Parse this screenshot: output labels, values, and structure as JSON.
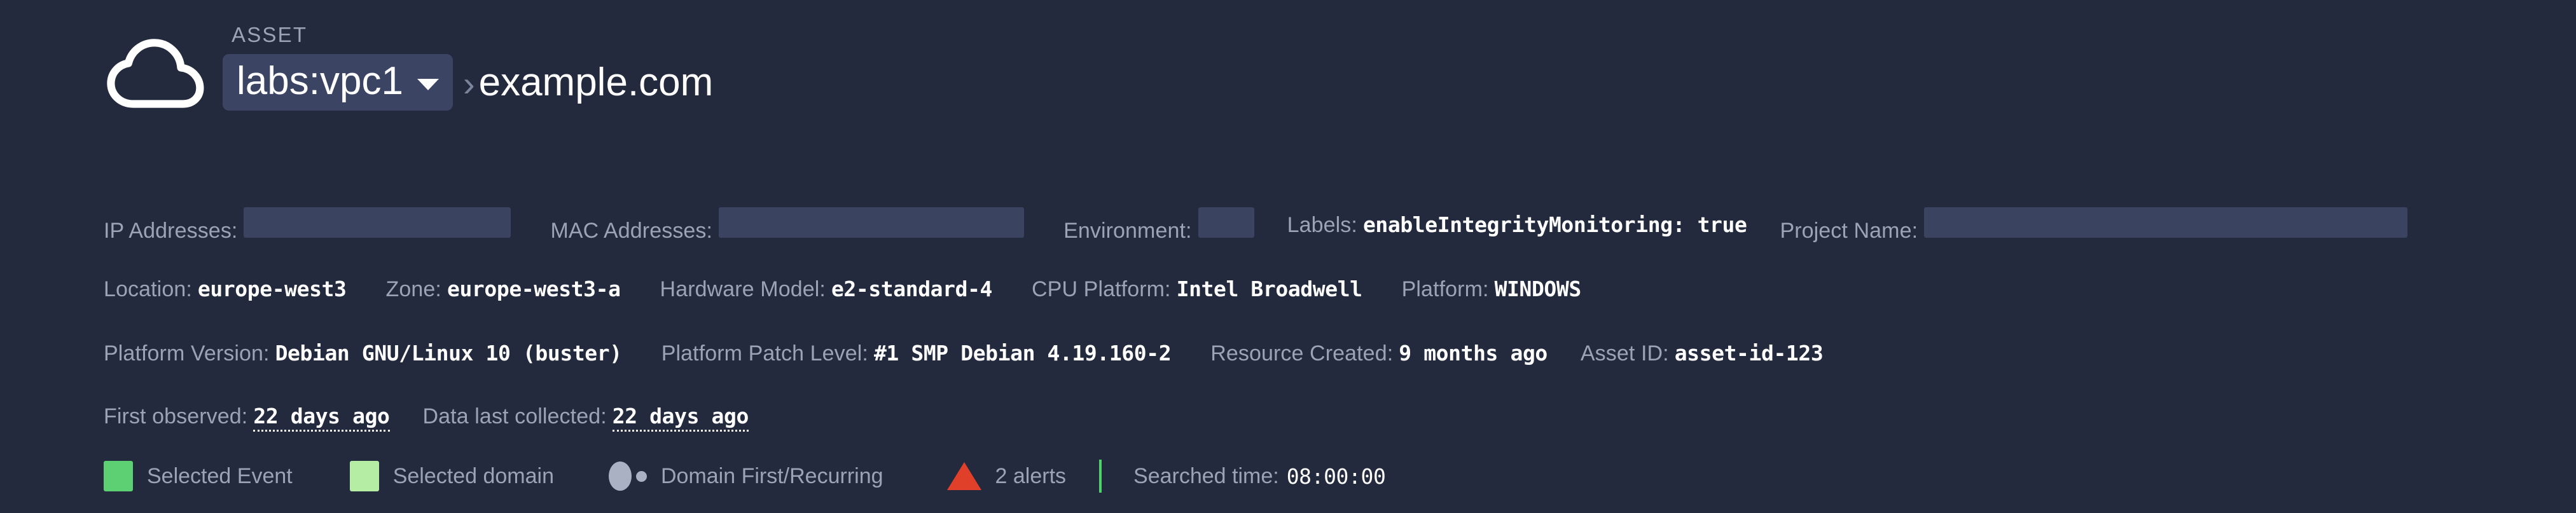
{
  "theme": {
    "background": "#242a3d",
    "label_color": "#9aa3b8",
    "value_color": "#ffffff",
    "chip_background": "#3b4563",
    "redaction_color": "#3a4360",
    "selected_event_color": "#5cd073",
    "selected_domain_color": "#b6eda4",
    "alert_color": "#e0402a",
    "divider_color": "#4fd16b",
    "marker_color": "#aab1c2"
  },
  "header": {
    "icon": "cloud-icon",
    "kicker": "ASSET",
    "asset_selector": {
      "value": "labs:vpc1",
      "caret_icon": "chevron-down-icon"
    },
    "separator": "›",
    "domain": "example.com"
  },
  "meta": {
    "row1": [
      {
        "label": "IP Addresses:",
        "value": null,
        "redacted": true
      },
      {
        "label": "MAC Addresses:",
        "value": null,
        "redacted": true
      },
      {
        "label": "Environment:",
        "value": null,
        "redacted": true
      },
      {
        "label": "Labels:",
        "value": "enableIntegrityMonitoring: true",
        "redacted": false
      },
      {
        "label": "Project Name:",
        "value": null,
        "redacted": true
      }
    ],
    "row2": [
      {
        "label": "Location:",
        "value": "europe-west3"
      },
      {
        "label": "Zone:",
        "value": "europe-west3-a"
      },
      {
        "label": "Hardware Model:",
        "value": "e2-standard-4"
      },
      {
        "label": "CPU Platform:",
        "value": "Intel Broadwell"
      },
      {
        "label": "Platform:",
        "value": "WINDOWS"
      }
    ],
    "row3": [
      {
        "label": "Platform Version:",
        "value": "Debian GNU/Linux 10 (buster)"
      },
      {
        "label": "Platform Patch Level:",
        "value": "#1 SMP Debian 4.19.160-2"
      },
      {
        "label": "Resource Created:",
        "value": "9 months ago"
      },
      {
        "label": "Asset ID:",
        "value": "asset-id-123"
      }
    ],
    "row4": [
      {
        "label": "First observed:",
        "value": "22 days ago",
        "underline": "dotted"
      },
      {
        "label": "Data last collected:",
        "value": "22 days ago",
        "underline": "dotted"
      }
    ]
  },
  "legend": {
    "selected_event": "Selected Event",
    "selected_domain": "Selected domain",
    "domain_first_recurring": "Domain First/Recurring",
    "alerts": "2 alerts",
    "searched_time_label": "Searched time:",
    "searched_time_value": "08:00:00"
  }
}
